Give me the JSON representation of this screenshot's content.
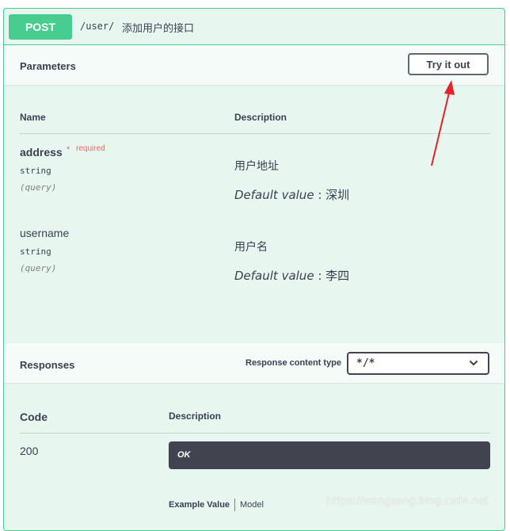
{
  "operation": {
    "method": "POST",
    "path": "/user/",
    "summary": "添加用户的接口"
  },
  "parameters": {
    "title": "Parameters",
    "try_button": "Try it out",
    "col_name": "Name",
    "col_description": "Description",
    "items": [
      {
        "name": "address",
        "required_mark": "*",
        "required_text": "required",
        "type": "string",
        "in": "(query)",
        "description": "用户地址",
        "default_label": "Default value",
        "default_sep": " : ",
        "default_value": "深圳"
      },
      {
        "name": "username",
        "type": "string",
        "in": "(query)",
        "description": "用户名",
        "default_label": "Default value",
        "default_sep": " : ",
        "default_value": "李四"
      }
    ]
  },
  "responses": {
    "title": "Responses",
    "content_type_label": "Response content type",
    "content_type_value": "*/*",
    "col_code": "Code",
    "col_description": "Description",
    "rows": [
      {
        "code": "200",
        "description": "OK"
      }
    ],
    "example_value_tab": "Example Value",
    "model_tab": "Model"
  },
  "watermark": "https://wangsong.blog.csdn.net",
  "colors": {
    "post_green": "#49cc90",
    "block_bg": "#e8f6f0",
    "dark_box": "#41444e",
    "required_red": "#ff6060",
    "annotation_arrow": "#e8202a"
  },
  "icons": {
    "select_chevron": "chevron-down-icon",
    "annotation": "red-arrow-annotation"
  }
}
